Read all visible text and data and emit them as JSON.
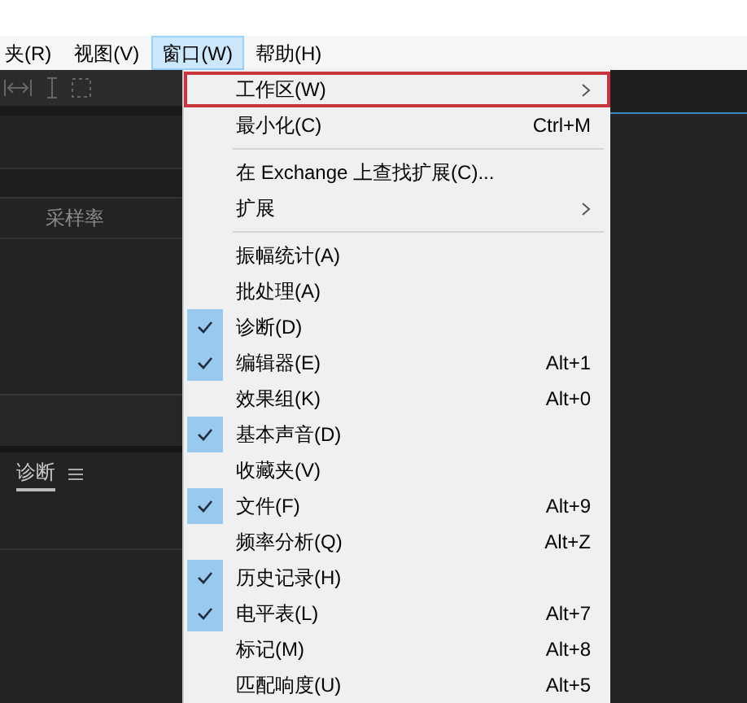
{
  "menu_bar": [
    {
      "label": "夹(R)",
      "selected": false
    },
    {
      "label": "视图(V)",
      "selected": false
    },
    {
      "label": "窗口(W)",
      "selected": true
    },
    {
      "label": "帮助(H)",
      "selected": false
    }
  ],
  "left_panel": {
    "column_header": "采样率",
    "tab": {
      "label": "诊断",
      "selected": true
    }
  },
  "dropdown": [
    {
      "kind": "item",
      "label": "工作区(W)",
      "submenu": true,
      "highlighted": true
    },
    {
      "kind": "item",
      "label": "最小化(C)",
      "shortcut": "Ctrl+M"
    },
    {
      "kind": "separator"
    },
    {
      "kind": "item",
      "label": "在 Exchange 上查找扩展(C)..."
    },
    {
      "kind": "item",
      "label": "扩展",
      "submenu": true
    },
    {
      "kind": "separator"
    },
    {
      "kind": "item",
      "label": "振幅统计(A)",
      "checked": false
    },
    {
      "kind": "item",
      "label": "批处理(A)",
      "checked": false
    },
    {
      "kind": "item",
      "label": "诊断(D)",
      "checked": true
    },
    {
      "kind": "item",
      "label": "编辑器(E)",
      "checked": true,
      "shortcut": "Alt+1"
    },
    {
      "kind": "item",
      "label": "效果组(K)",
      "checked": false,
      "shortcut": "Alt+0"
    },
    {
      "kind": "item",
      "label": "基本声音(D)",
      "checked": true
    },
    {
      "kind": "item",
      "label": "收藏夹(V)",
      "checked": false
    },
    {
      "kind": "item",
      "label": "文件(F)",
      "checked": true,
      "shortcut": "Alt+9"
    },
    {
      "kind": "item",
      "label": "频率分析(Q)",
      "checked": false,
      "shortcut": "Alt+Z"
    },
    {
      "kind": "item",
      "label": "历史记录(H)",
      "checked": true
    },
    {
      "kind": "item",
      "label": "电平表(L)",
      "checked": true,
      "shortcut": "Alt+7"
    },
    {
      "kind": "item",
      "label": "标记(M)",
      "checked": false,
      "shortcut": "Alt+8"
    },
    {
      "kind": "item",
      "label": "匹配响度(U)",
      "checked": false,
      "shortcut": "Alt+5"
    }
  ]
}
